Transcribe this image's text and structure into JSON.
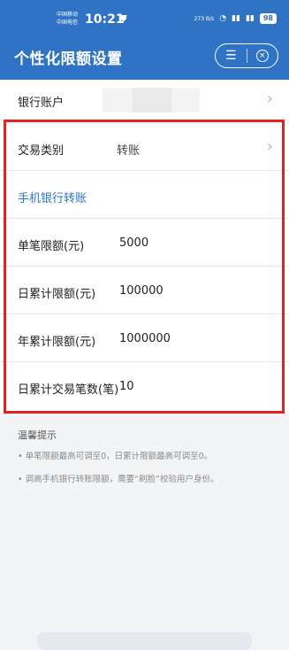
{
  "status_bar": {
    "carrier_1": "中国移动",
    "carrier_2": "中国电信",
    "time": "10:21",
    "net_speed": "273 B/s",
    "battery": "98"
  },
  "header": {
    "title": "个性化限额设置"
  },
  "bank_account": {
    "label": "银行账户"
  },
  "transaction_type": {
    "label": "交易类别",
    "value": "转账"
  },
  "section": {
    "title": "手机银行转账"
  },
  "limits": [
    {
      "label": "单笔限额(元)",
      "value": "5000"
    },
    {
      "label": "日累计限额(元)",
      "value": "100000"
    },
    {
      "label": "年累计限额(元)",
      "value": "1000000"
    },
    {
      "label": "日累计交易笔数(笔)",
      "value": "10"
    }
  ],
  "tips": {
    "title": "温馨提示",
    "items": [
      "• 单笔限额最高可调至0，日累计限额最高可调至0。",
      "• 调高手机银行转账限额，需要“刷脸”校验用户身份。"
    ]
  },
  "colors": {
    "header_bg": "#2f73c4",
    "highlight_border": "#e02424",
    "section_title": "#2f73c4"
  }
}
